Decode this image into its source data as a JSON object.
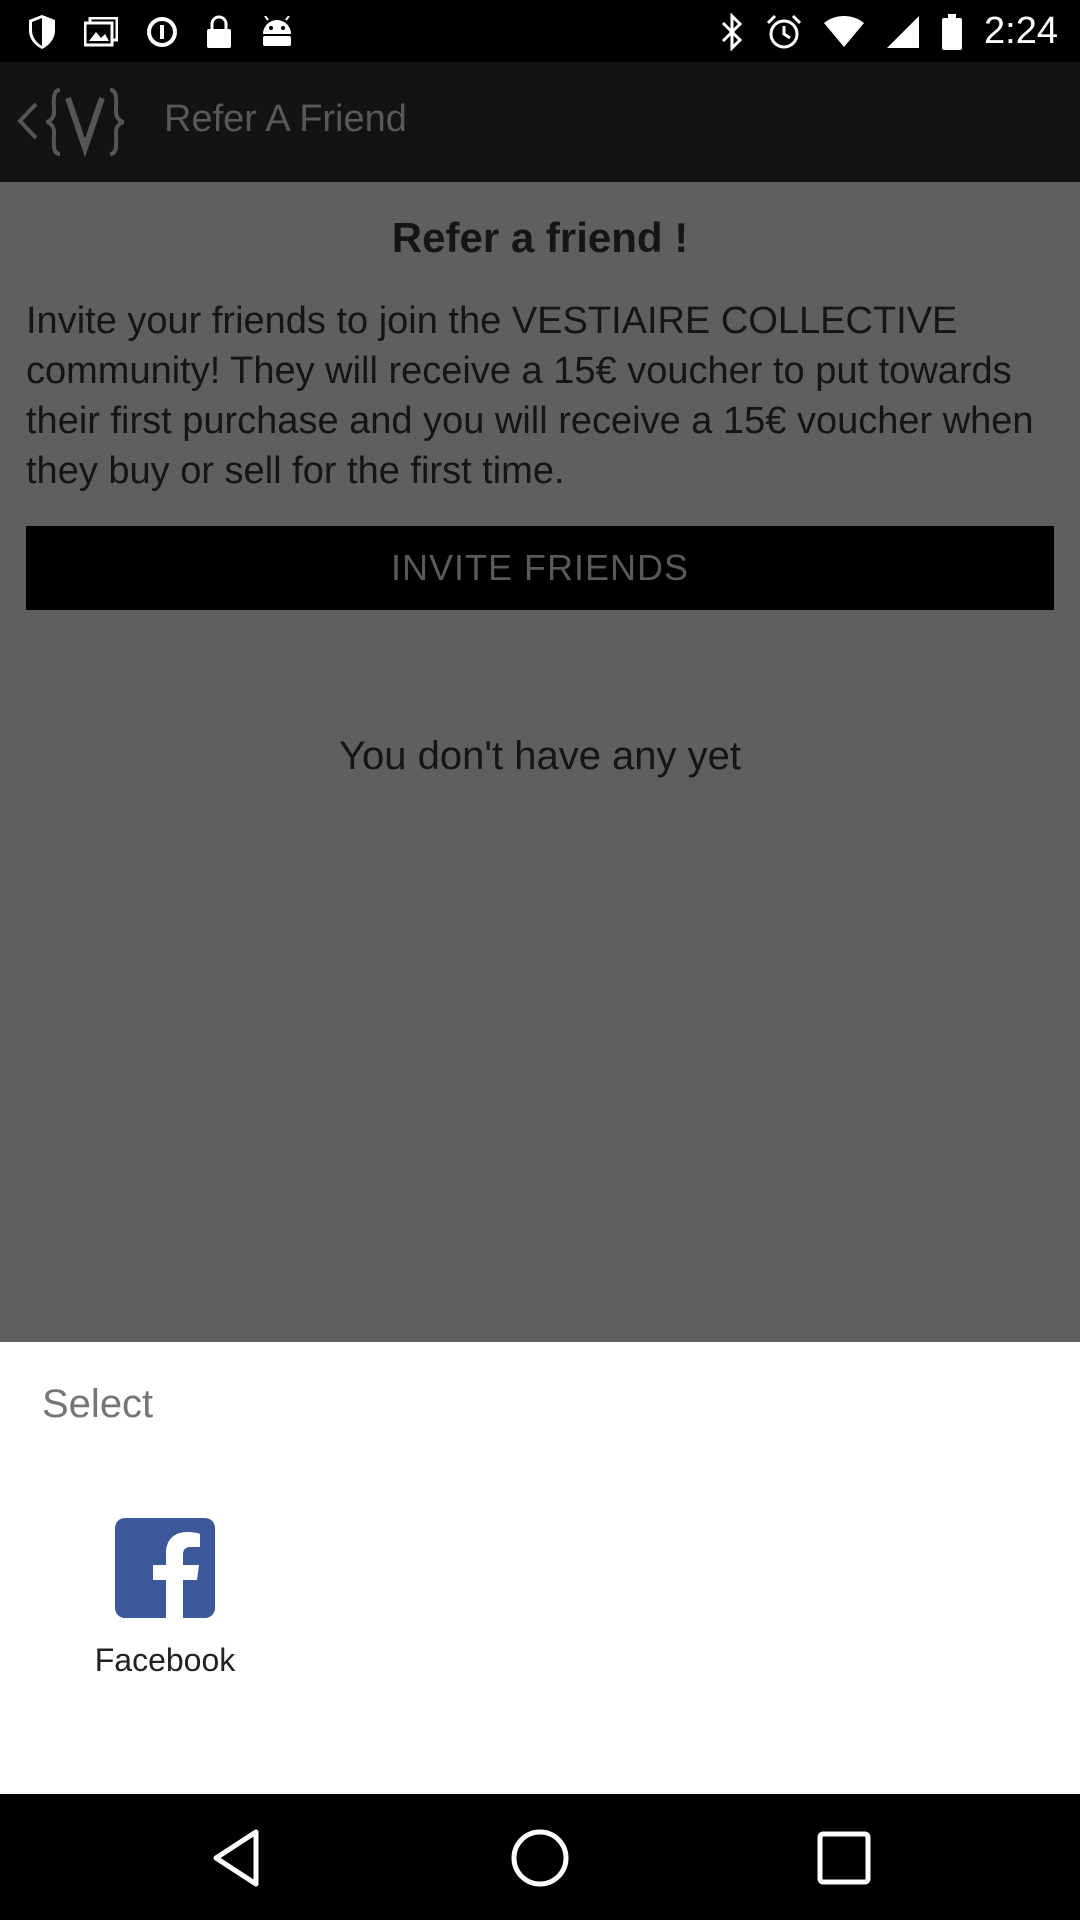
{
  "status_bar": {
    "time": "2:24",
    "icons": [
      "shield-icon",
      "image-icon",
      "data-saver-icon",
      "lock-icon",
      "android-icon",
      "bluetooth-icon",
      "alarm-icon",
      "wifi-icon",
      "signal-icon",
      "battery-icon"
    ]
  },
  "app_bar": {
    "title": "Refer A Friend",
    "back_icon": "chevron-left-icon",
    "logo_icon": "vestiaire-logo-icon"
  },
  "content": {
    "heading": "Refer a friend !",
    "body": "Invite your friends to join the VESTIAIRE COLLECTIVE community! They will receive a 15€ voucher to put towards their first purchase and you will receive a 15€ voucher when they buy or sell for the first time.",
    "invite_button": "INVITE FRIENDS",
    "empty_state": "You don't have any yet"
  },
  "share_sheet": {
    "title": "Select",
    "apps": [
      {
        "label": "Facebook",
        "icon": "facebook-icon",
        "color": "#3b5998"
      }
    ]
  },
  "nav_bar": {
    "buttons": [
      "back-triangle-icon",
      "home-circle-icon",
      "recents-square-icon"
    ]
  }
}
